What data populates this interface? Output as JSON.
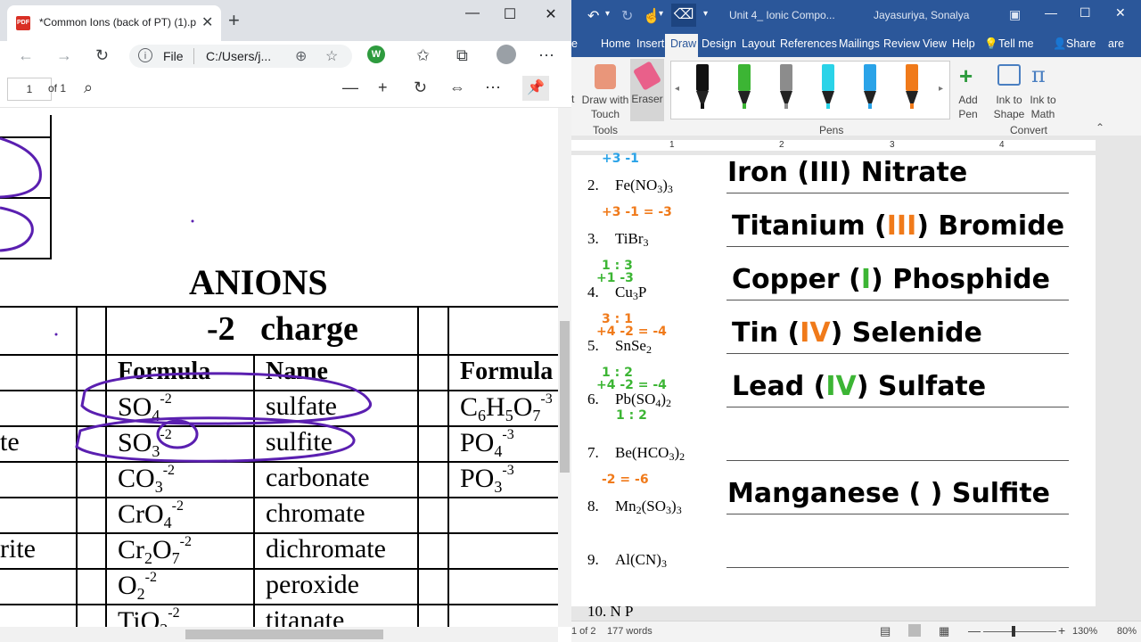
{
  "pdf_viewer": {
    "tab_title": "*Common Ions (back of PT) (1).p",
    "pdf_badge": "PDF",
    "address_scheme": "File",
    "address_url": "C:/Users/j...",
    "page_number": "1",
    "page_count_label": "of 1",
    "document": {
      "heading": "ANIONS",
      "section_heading": "-2   charge",
      "col_formula": "Formula",
      "col_name": "Name",
      "col_formula_2": "Formula",
      "left_fragments": [
        "te",
        "rite"
      ],
      "rows": [
        {
          "formula": "SO",
          "sub": "4",
          "sup": "-2",
          "name": "sulfate"
        },
        {
          "formula": "SO",
          "sub": "3",
          "sup": "-2",
          "name": "sulfite"
        },
        {
          "formula": "CO",
          "sub": "3",
          "sup": "-2",
          "name": "carbonate"
        },
        {
          "formula": "CrO",
          "sub": "4",
          "sup": "-2",
          "name": "chromate"
        },
        {
          "formula": "Cr",
          "sub": "2",
          "formula2": "O",
          "sub2": "7",
          "sup": "-2",
          "name": "dichromate"
        },
        {
          "formula": "O",
          "sub": "2",
          "sup": "-2",
          "name": "peroxide"
        },
        {
          "formula": "TiO",
          "sub": "3",
          "sup": "-2",
          "name": "titanate"
        }
      ],
      "right_rows": [
        {
          "parts": [
            "C",
            "6",
            "H",
            "5",
            "O",
            "7"
          ],
          "sup": "-3"
        },
        {
          "formula": "PO",
          "sub": "4",
          "sup": "-3"
        },
        {
          "formula": "PO",
          "sub": "3",
          "sup": "-3"
        }
      ]
    }
  },
  "word": {
    "doc_title": "Unit 4_ Ionic Compo...",
    "user_name": "Jayasuriya, Sonalya",
    "ribbon_tabs": [
      "e",
      "Home",
      "Insert",
      "Draw",
      "Design",
      "Layout",
      "References",
      "Mailings",
      "Review",
      "View",
      "Help",
      "Tell me",
      "Share",
      "are"
    ],
    "active_tab": "Draw",
    "tools": {
      "draw_with_touch": "Draw with Touch",
      "eraser": "Eraser",
      "group_label": "Tools",
      "prefix": "t"
    },
    "pens_group_label": "Pens",
    "add_pen": "Add Pen",
    "ink_to_shape": "Ink to Shape",
    "ink_to_math": "Ink to Math",
    "convert_group_label": "Convert",
    "ruler_numbers": [
      "1",
      "2",
      "3",
      "4"
    ],
    "pen_colors": [
      "#111111",
      "#3cb534",
      "#8c8c8c",
      "#2ad3e8",
      "#2aa3e8",
      "#f07a1a"
    ],
    "questions": [
      {
        "num": "2.",
        "parts": [
          "Fe(NO",
          "3",
          ")",
          "3"
        ],
        "answer": "Iron (III) Nitrate",
        "ink_top": "+3   -1",
        "ink_color": "#2aa3e8"
      },
      {
        "num": "3.",
        "parts": [
          "TiBr",
          "3"
        ],
        "answer_a": "Titanium (",
        "answer_roman": "III",
        "answer_b": ") Bromide",
        "ink_top": "+3  -1 = -3",
        "ink_color": "#f07a1a"
      },
      {
        "num": "4.",
        "parts": [
          "Cu",
          "3",
          "P"
        ],
        "answer_a": "Copper (",
        "answer_roman": "I",
        "answer_b": ") Phosphide",
        "ink_top": "1 : 3",
        "ink_top2": "+1  -3",
        "ink_color": "#3cb534"
      },
      {
        "num": "5.",
        "parts": [
          "SnSe",
          "2"
        ],
        "answer_a": "Tin (",
        "answer_roman": "IV",
        "answer_b": ") Selenide",
        "ink_top": "3 : 1",
        "ink_top2": "+4  -2 = -4",
        "ink_color": "#f07a1a"
      },
      {
        "num": "6.",
        "parts": [
          "Pb(SO",
          "4",
          ")",
          "2"
        ],
        "answer_a": "Lead (",
        "answer_roman": "IV",
        "answer_b": ") Sulfate",
        "ink_top": "1 : 2",
        "ink_top2": "+4  -2 = -4",
        "ink_bottom": "1 : 2",
        "ink_color": "#3cb534"
      },
      {
        "num": "7.",
        "parts": [
          "Be(HCO",
          "3",
          ")",
          "2"
        ],
        "answer": ""
      },
      {
        "num": "8.",
        "parts": [
          "Mn",
          "2",
          "(SO",
          "3",
          ")",
          "3"
        ],
        "answer": "Manganese (   ) Sulfite",
        "ink_top": "-2   = -6",
        "ink_color": "#f07a1a"
      },
      {
        "num": "9.",
        "parts": [
          "Al(CN)",
          "3"
        ],
        "answer": ""
      }
    ],
    "next_num_partial": "10. N P",
    "status": {
      "pages": "1 of 2",
      "words": "177 words",
      "zoom": "130%",
      "zoom_right": "80%"
    }
  }
}
